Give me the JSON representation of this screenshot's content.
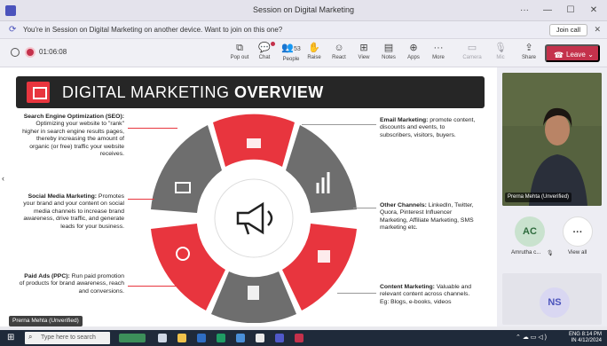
{
  "window": {
    "title": "Session on Digital Marketing",
    "controls": [
      "···",
      "—",
      "☐",
      "✕"
    ]
  },
  "notice": {
    "message": "You're in Session on Digital Marketing on another device. Want to join on this one?",
    "join_label": "Join call",
    "close": "✕"
  },
  "toolbar": {
    "timer": "01:06:08",
    "buttons": [
      {
        "label": "Pop out",
        "icon": "⧉"
      },
      {
        "label": "Chat",
        "icon": "💬"
      },
      {
        "label": "People",
        "icon": "👥",
        "count": "53"
      },
      {
        "label": "Raise",
        "icon": "✋"
      },
      {
        "label": "React",
        "icon": "☺"
      },
      {
        "label": "View",
        "icon": "⊞"
      },
      {
        "label": "Notes",
        "icon": "▤"
      },
      {
        "label": "Apps",
        "icon": "⊕"
      },
      {
        "label": "More",
        "icon": "···"
      },
      {
        "label": "Camera",
        "icon": "▭"
      },
      {
        "label": "Mic",
        "icon": "🎙"
      },
      {
        "label": "Share",
        "icon": "⇪"
      }
    ],
    "leave_label": "Leave",
    "leave_icon": "☎"
  },
  "slide": {
    "title_light": "DIGITAL MARKETING",
    "title_bold": "OVERVIEW",
    "items": {
      "seo": {
        "heading": "Search Engine Optimization (SEO):",
        "body": "Optimizing your website to \"rank\" higher in search engine results pages, thereby increasing the amount of organic (or free) traffic your website receives."
      },
      "smm": {
        "heading": "Social Media Marketing:",
        "body": "Promotes your brand and your content on social media channels to increase brand awareness, drive traffic, and generate leads for your business."
      },
      "ppc": {
        "heading": "Paid Ads (PPC):",
        "body": "Run paid promotion of products for brand awareness, reach and conversions."
      },
      "email": {
        "heading": "Email Marketing:",
        "body": "promote content, discounts and events, to subscribers, visitors, buyers."
      },
      "other": {
        "heading": "Other Channels:",
        "body": "LinkedIn, Twitter, Quora, Pinterest Influencer Marketing, Affiliate Marketing, SMS marketing etc."
      },
      "content": {
        "heading": "Content Marketing:",
        "body": "Valuable and relevant content across channels. Eg: Blogs, e-books, videos"
      }
    },
    "colors": {
      "red": "#e8353e",
      "grey": "#6e6e6e",
      "dark": "#262626"
    }
  },
  "presenter_tag": "Prerna Mehta (Unverified)",
  "participants": {
    "video_name": "Prerna Mehta (Unverified)",
    "ac_initials": "AC",
    "ac_label": "Amrutha c...",
    "view_all_label": "View all",
    "view_all_glyph": "···",
    "ns_initials": "NS"
  },
  "taskbar": {
    "search_placeholder": "Type here to search",
    "lang": "ENG",
    "region": "IN",
    "time": "8:14 PM",
    "date": "4/12/2024"
  }
}
